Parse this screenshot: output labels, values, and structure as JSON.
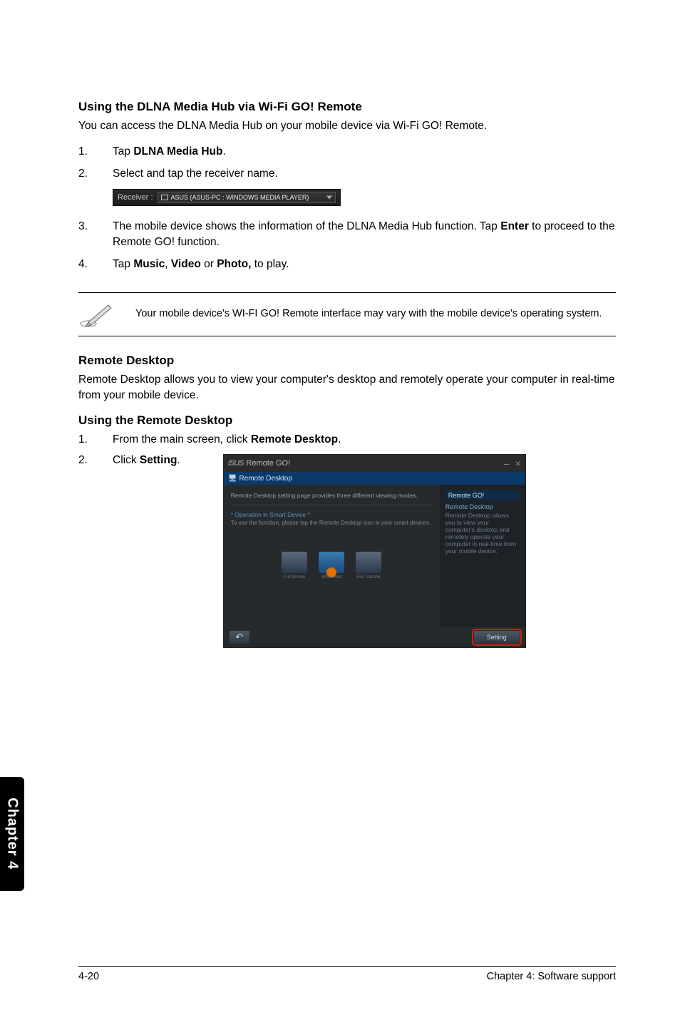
{
  "section1": {
    "heading": "Using the DLNA Media Hub via Wi-Fi GO! Remote",
    "intro": "You can access the DLNA Media Hub on your mobile device via Wi-Fi GO! Remote.",
    "steps": {
      "s1": {
        "num": "1.",
        "prefix": "Tap ",
        "bold": "DLNA Media Hub",
        "suffix": "."
      },
      "s2": {
        "num": "2.",
        "text": "Select and tap the receiver name."
      },
      "s3": {
        "num": "3.",
        "prefix": "The mobile device shows the information of the DLNA Media Hub function. Tap ",
        "bold": "Enter",
        "suffix": " to proceed to the Remote GO! function."
      },
      "s4": {
        "num": "4.",
        "p1": "Tap ",
        "b1": "Music",
        "c1": ", ",
        "b2": "Video",
        "c2": " or ",
        "b3": "Photo,",
        "p2": " to play."
      }
    }
  },
  "receiver": {
    "label": "Receiver :",
    "value": "ASUS (ASUS-PC : WINDOWS MEDIA PLAYER)"
  },
  "note": "Your mobile device's WI-FI GO! Remote interface may vary with the mobile device's operating system.",
  "section2": {
    "heading": "Remote Desktop",
    "intro": "Remote Desktop allows you to view your computer's desktop and remotely operate your computer in real-time from your mobile device.",
    "subheading": "Using the Remote Desktop",
    "steps": {
      "s1": {
        "num": "1.",
        "prefix": "From the main screen, click ",
        "bold": "Remote Desktop",
        "suffix": "."
      },
      "s2": {
        "num": "2.",
        "prefix": "Click ",
        "bold": "Setting",
        "suffix": "."
      }
    }
  },
  "screenshot": {
    "brand": "/SUS",
    "title": "Remote GO!",
    "min": "–",
    "close": "×",
    "bluebar": "Remote Desktop",
    "main_line1": "Remote Desktop setting page provides three different viewing modes.",
    "main_line2": "* Operation in Smart Device *",
    "main_line3": "To use the function, please tap the Remote Desktop icon in your smart devices.",
    "side_title": "Remote GO!",
    "side_h": "Remote Desktop",
    "side_body": "Remote Desktop allows you to view your computer's desktop and remotely operate your computer in real-time from your mobile device.",
    "icon_labels": {
      "a": "Full Screen",
      "b": "Windowed",
      "c": "File Transfer"
    },
    "back": "↶",
    "setting": "Setting"
  },
  "tab": "Chapter 4",
  "footer": {
    "left": "4-20",
    "right": "Chapter 4: Software support"
  }
}
